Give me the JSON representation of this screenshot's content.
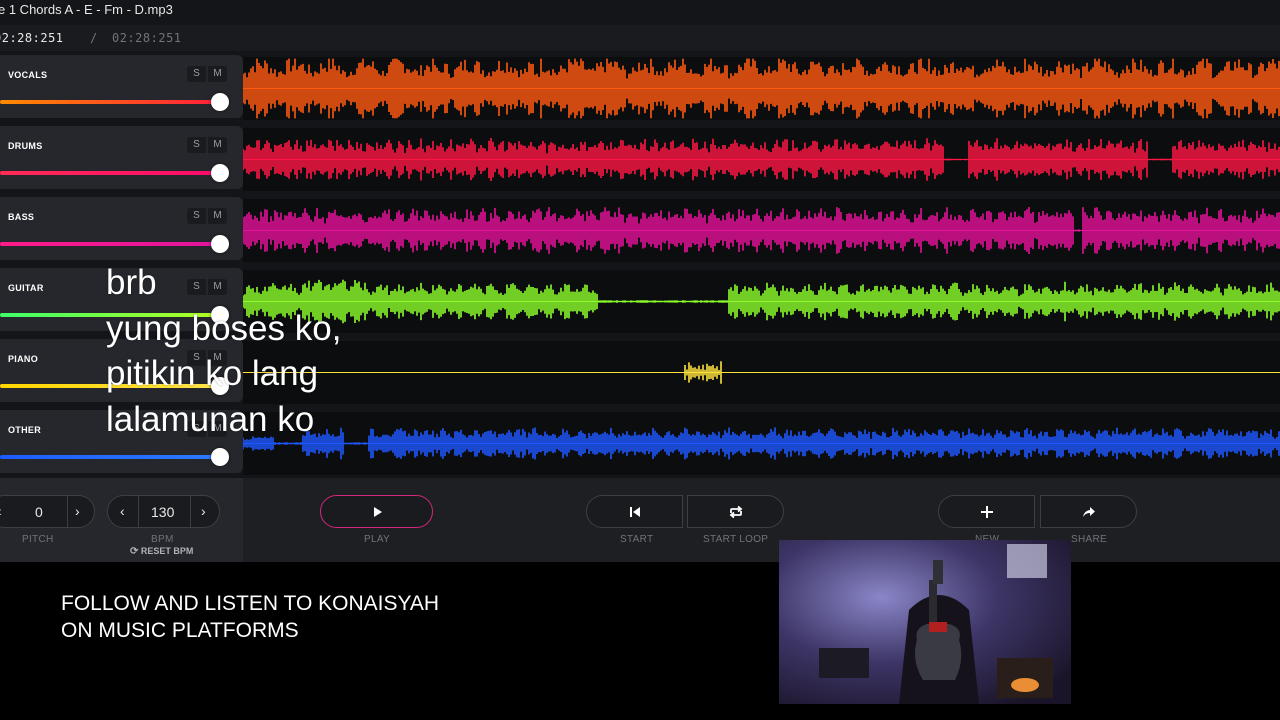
{
  "window": {
    "title": "e 1 Chords A - E - Fm - D.mp3"
  },
  "time": {
    "current": "02:28:251",
    "separator": "/",
    "total": "02:28:251"
  },
  "tracks": [
    {
      "name": "VOCALS",
      "solo": "S",
      "mute": "M",
      "color_from": "#ff8a00",
      "color_to": "#ff1e3c",
      "wave": "#ff5a10",
      "volume_percent": 100
    },
    {
      "name": "DRUMS",
      "solo": "S",
      "mute": "M",
      "color_from": "#ff2b55",
      "color_to": "#ff0a6c",
      "wave": "#ff1744",
      "volume_percent": 100
    },
    {
      "name": "BASS",
      "solo": "S",
      "mute": "M",
      "color_from": "#ff1c8a",
      "color_to": "#e0149e",
      "wave": "#e6129a",
      "volume_percent": 100
    },
    {
      "name": "GUITAR",
      "solo": "S",
      "mute": "M",
      "color_from": "#3dff6a",
      "color_to": "#b4ff1e",
      "wave": "#8cff2a",
      "volume_percent": 100
    },
    {
      "name": "PIANO",
      "solo": "S",
      "mute": "M",
      "color_from": "#ffd600",
      "color_to": "#ffe34a",
      "wave": "#ffe23c",
      "volume_percent": 100
    },
    {
      "name": "OTHER",
      "solo": "S",
      "mute": "M",
      "color_from": "#1e5cff",
      "color_to": "#2a7bff",
      "wave": "#1f57ff",
      "volume_percent": 100
    }
  ],
  "controls": {
    "pitch": {
      "value": "0",
      "label": "PITCH",
      "dec": "‹",
      "inc": "›"
    },
    "bpm": {
      "value": "130",
      "label": "BPM",
      "dec": "‹",
      "inc": "›",
      "reset": "RESET BPM"
    },
    "play": {
      "label": "PLAY",
      "icon": "play-icon"
    },
    "start": {
      "label": "START",
      "icon": "skip-start-icon"
    },
    "start_loop": {
      "label": "START LOOP",
      "icon": "loop-icon"
    },
    "new": {
      "label": "NEW",
      "icon": "plus-icon"
    },
    "share": {
      "label": "SHARE",
      "icon": "share-arrow-icon"
    }
  },
  "overlay": {
    "lyrics": [
      "brb",
      "yung boses ko,",
      "pitikin ko lang",
      "lalamunan ko"
    ],
    "follow": [
      "FOLLOW AND LISTEN TO KONAISYAH",
      "ON MUSIC PLATFORMS"
    ]
  },
  "accent": "#d4267b"
}
